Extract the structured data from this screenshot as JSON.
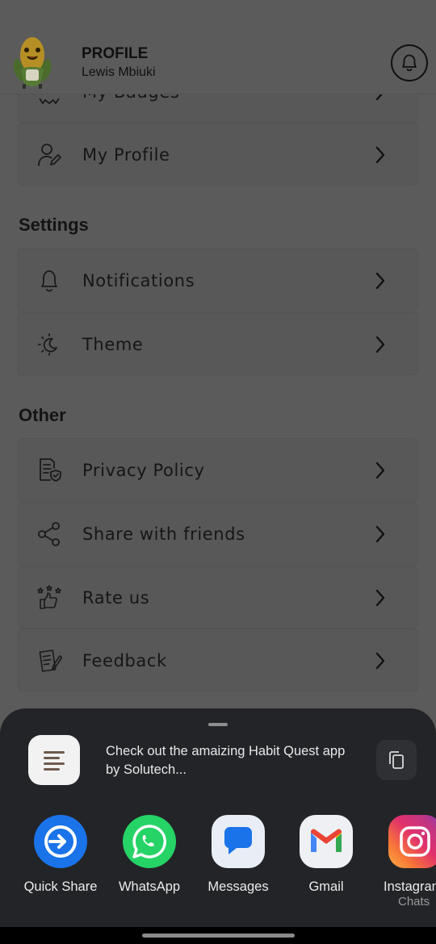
{
  "header": {
    "title": "PROFILE",
    "user_name": "Lewis Mbiuki"
  },
  "menu": {
    "partial_item": "My Badges",
    "profile_item": "My Profile"
  },
  "sections": {
    "settings": {
      "title": "Settings",
      "items": [
        {
          "label": "Notifications",
          "icon": "bell-icon"
        },
        {
          "label": "Theme",
          "icon": "theme-icon"
        }
      ]
    },
    "other": {
      "title": "Other",
      "items": [
        {
          "label": "Privacy Policy",
          "icon": "document-shield-icon"
        },
        {
          "label": "Share with friends",
          "icon": "share-icon"
        },
        {
          "label": "Rate us",
          "icon": "thumbs-up-stars-icon"
        },
        {
          "label": "Feedback",
          "icon": "notepad-pen-icon"
        }
      ]
    }
  },
  "share_sheet": {
    "preview_text": "Check out the amaizing Habit Quest app by Solutech...",
    "targets": [
      {
        "name": "Quick Share",
        "sub": "",
        "color": "#1a73e8"
      },
      {
        "name": "WhatsApp",
        "sub": "",
        "color": "#25d366"
      },
      {
        "name": "Messages",
        "sub": "",
        "color": "#1a73e8"
      },
      {
        "name": "Gmail",
        "sub": "",
        "color": "#ea4335"
      },
      {
        "name": "Instagram",
        "sub": "Chats",
        "color": "#e1306c"
      }
    ]
  },
  "colors": {
    "scrim_background": "#5b5b5b",
    "sheet_background": "#232427"
  }
}
